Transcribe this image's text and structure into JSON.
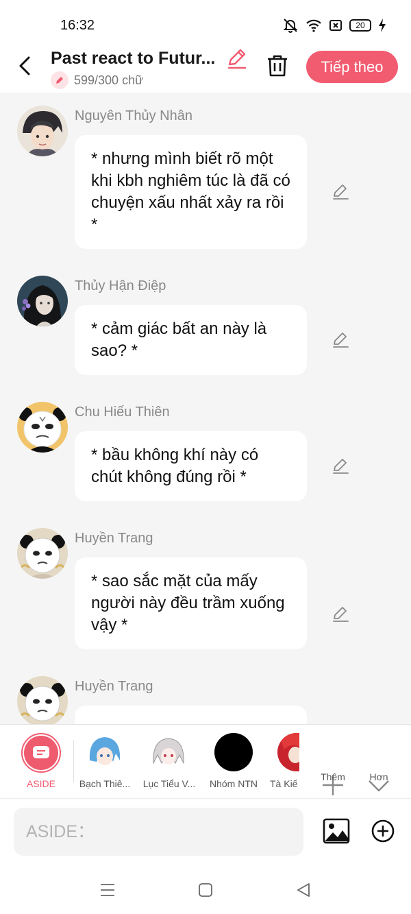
{
  "status_bar": {
    "time": "16:32",
    "battery": "20"
  },
  "header": {
    "title": "Past react to Futur...",
    "word_count": "599/300 chữ",
    "next_label": "Tiếp theo"
  },
  "messages": [
    {
      "sender": "Nguyên Thủy Nhân",
      "text": "* nhưng mình biết rõ một khi kbh nghiêm túc là đã có chuyện xấu nhất xảy ra rồi *"
    },
    {
      "sender": "Thủy Hận Điệp",
      "text": "* cảm giác bất an này là sao? *"
    },
    {
      "sender": "Chu Hiếu Thiên",
      "text": "* bầu không khí này có chút không đúng rồi *"
    },
    {
      "sender": "Huyền Trang",
      "text": "* sao sắc mặt của mấy người này đều trầm xuống vậy *"
    },
    {
      "sender": "Huyền Trang",
      "text": ""
    }
  ],
  "characters": [
    {
      "name": "ASIDE"
    },
    {
      "name": "Bạch Thiê..."
    },
    {
      "name": "Lục Tiểu V..."
    },
    {
      "name": "Nhóm NTN"
    },
    {
      "name": "Tà Kiế"
    }
  ],
  "char_actions": {
    "add_label": "Thêm",
    "more_label": "Hơn"
  },
  "input": {
    "placeholder": "ASIDE："
  },
  "colors": {
    "accent": "#f25c70",
    "background": "#f5f5f5",
    "bubble": "#ffffff",
    "sender_text": "#888888"
  }
}
